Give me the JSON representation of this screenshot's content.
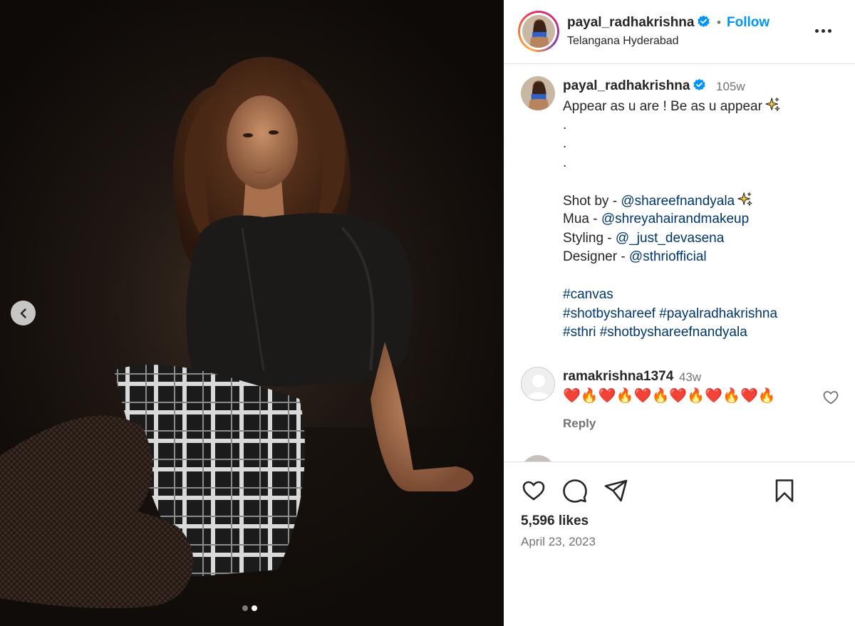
{
  "post": {
    "username": "payal_radhakrishna",
    "verified": true,
    "location": "Telangana Hyderabad",
    "follow_label": "Follow",
    "separator": "•",
    "caption": {
      "time": "105w",
      "lines": [
        "Appear as u are ! Be as u appear",
        ".",
        ".",
        ".",
        ""
      ],
      "credits": [
        {
          "prefix": "Shot by - ",
          "handle": "@shareefnandyala",
          "sparkle": true
        },
        {
          "prefix": "Mua - ",
          "handle": "@shreyahairandmakeup"
        },
        {
          "prefix": "Styling - ",
          "handle": "@_just_devasena"
        },
        {
          "prefix": "Designer - ",
          "handle": "@sthriofficial"
        }
      ],
      "hashtags": [
        "#canvas",
        "#shotbyshareef #payalradhakrishna",
        "#sthri #shotbyshareefnandyala"
      ]
    },
    "comment": {
      "username": "ramakrishna1374",
      "time": "43w",
      "text": "❤️🔥❤️🔥❤️🔥❤️🔥❤️🔥❤️🔥",
      "reply_label": "Reply"
    },
    "likes": "5,596 likes",
    "date": "April 23, 2023",
    "carousel": {
      "count": 2,
      "active_index": 1
    }
  },
  "icons": {
    "prev": "chevron-left-icon",
    "like": "heart-icon",
    "comment": "comment-bubble-icon",
    "share": "paper-plane-icon",
    "save": "bookmark-icon",
    "more": "more-horizontal-icon",
    "verified": "verified-badge-icon"
  },
  "colors": {
    "link": "#00376b",
    "follow": "#0095f6",
    "verified": "#0095f6",
    "muted": "#737373",
    "text": "#262626"
  }
}
